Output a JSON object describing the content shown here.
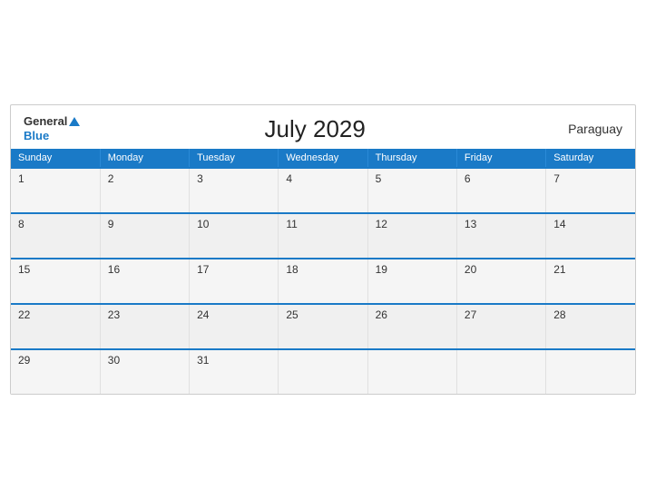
{
  "header": {
    "logo_general": "General",
    "logo_blue": "Blue",
    "title": "July 2029",
    "country": "Paraguay"
  },
  "weekdays": [
    "Sunday",
    "Monday",
    "Tuesday",
    "Wednesday",
    "Thursday",
    "Friday",
    "Saturday"
  ],
  "weeks": [
    [
      {
        "day": "1"
      },
      {
        "day": "2"
      },
      {
        "day": "3"
      },
      {
        "day": "4"
      },
      {
        "day": "5"
      },
      {
        "day": "6"
      },
      {
        "day": "7"
      }
    ],
    [
      {
        "day": "8"
      },
      {
        "day": "9"
      },
      {
        "day": "10"
      },
      {
        "day": "11"
      },
      {
        "day": "12"
      },
      {
        "day": "13"
      },
      {
        "day": "14"
      }
    ],
    [
      {
        "day": "15"
      },
      {
        "day": "16"
      },
      {
        "day": "17"
      },
      {
        "day": "18"
      },
      {
        "day": "19"
      },
      {
        "day": "20"
      },
      {
        "day": "21"
      }
    ],
    [
      {
        "day": "22"
      },
      {
        "day": "23"
      },
      {
        "day": "24"
      },
      {
        "day": "25"
      },
      {
        "day": "26"
      },
      {
        "day": "27"
      },
      {
        "day": "28"
      }
    ],
    [
      {
        "day": "29"
      },
      {
        "day": "30"
      },
      {
        "day": "31"
      },
      {
        "day": ""
      },
      {
        "day": ""
      },
      {
        "day": ""
      },
      {
        "day": ""
      }
    ]
  ]
}
